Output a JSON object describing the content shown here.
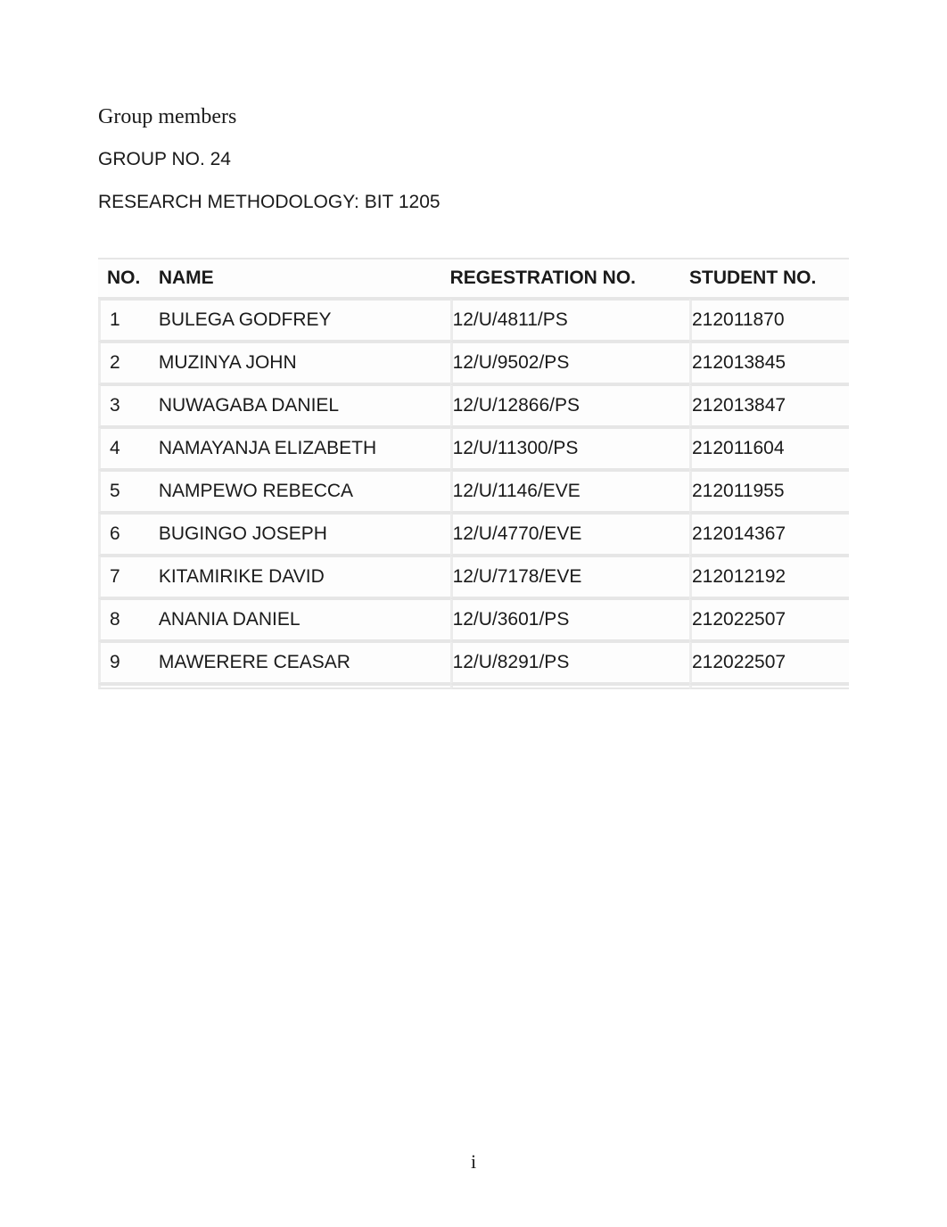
{
  "header": {
    "title": "Group members",
    "group_line": "GROUP NO. 24",
    "course_line": "RESEARCH METHODOLOGY: BIT 1205"
  },
  "table": {
    "columns": {
      "no": "NO.",
      "name": "NAME",
      "reg": "REGESTRATION NO.",
      "student": "STUDENT NO."
    },
    "rows": [
      {
        "no": "1",
        "name": "BULEGA GODFREY",
        "reg": "12/U/4811/PS",
        "student": "212011870"
      },
      {
        "no": "2",
        "name": "MUZINYA JOHN",
        "reg": "12/U/9502/PS",
        "student": "212013845"
      },
      {
        "no": "3",
        "name": "NUWAGABA DANIEL",
        "reg": "12/U/12866/PS",
        "student": "212013847"
      },
      {
        "no": "4",
        "name": "NAMAYANJA ELIZABETH",
        "reg": "12/U/11300/PS",
        "student": "212011604"
      },
      {
        "no": "5",
        "name": "NAMPEWO REBECCA",
        "reg": "12/U/1146/EVE",
        "student": "212011955"
      },
      {
        "no": "6",
        "name": "BUGINGO JOSEPH",
        "reg": "12/U/4770/EVE",
        "student": "212014367"
      },
      {
        "no": "7",
        "name": "KITAMIRIKE DAVID",
        "reg": "12/U/7178/EVE",
        "student": "212012192"
      },
      {
        "no": "8",
        "name": "ANANIA DANIEL",
        "reg": "12/U/3601/PS",
        "student": "212022507"
      },
      {
        "no": "9",
        "name": "MAWERERE CEASAR",
        "reg": "12/U/8291/PS",
        "student": "212022507"
      }
    ]
  },
  "footer": {
    "page_number": "i"
  }
}
